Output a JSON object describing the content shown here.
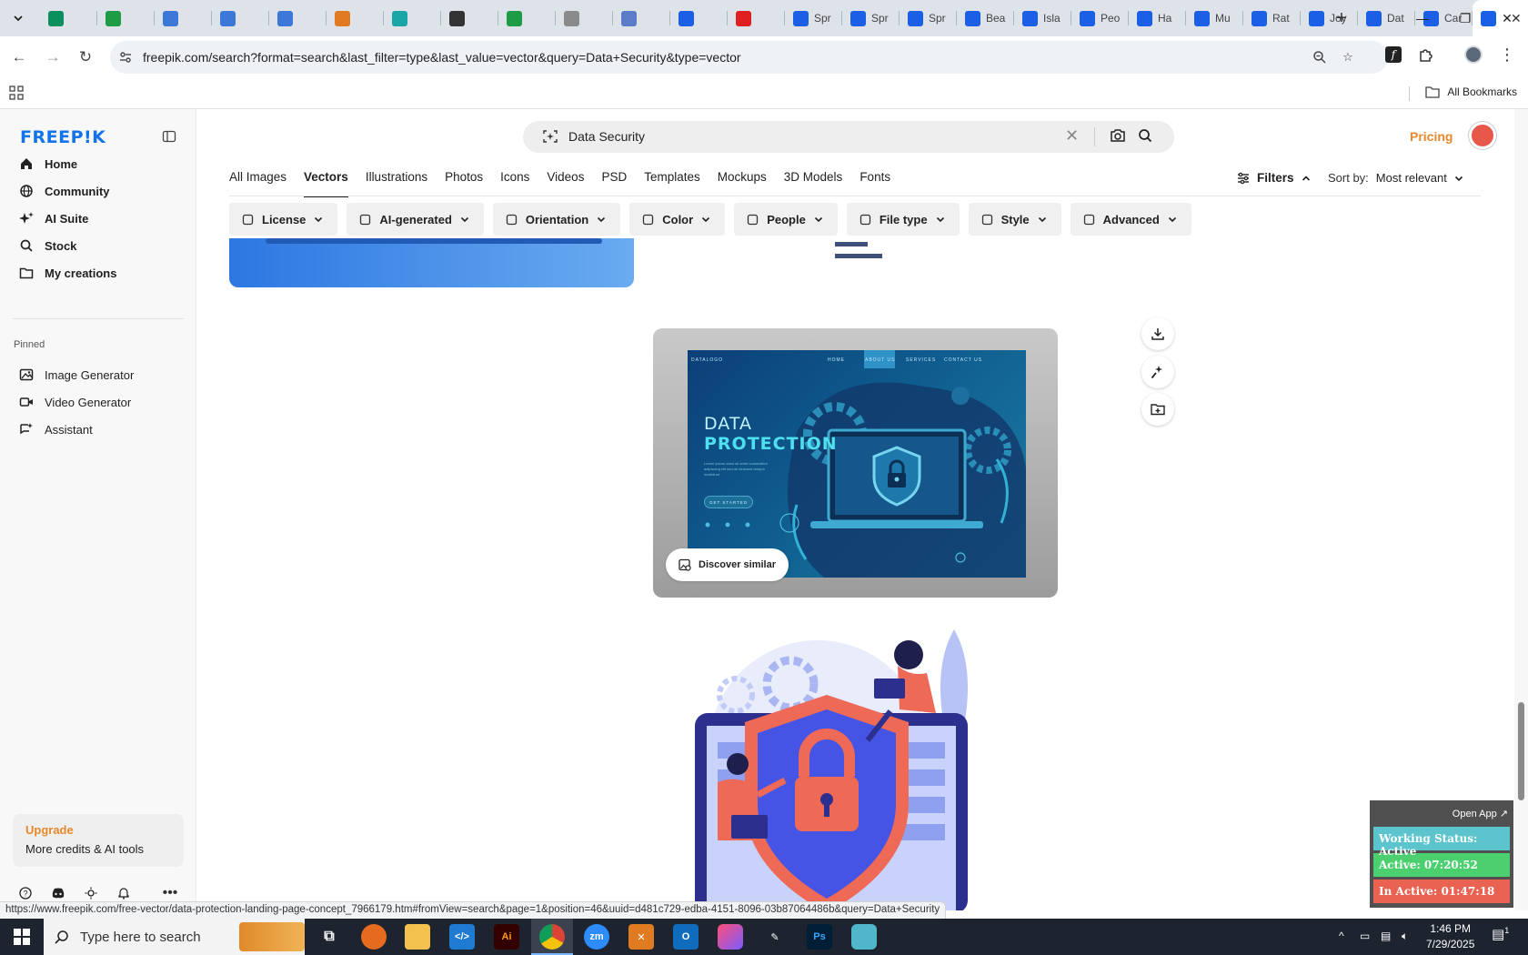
{
  "browser": {
    "tabs": [
      {
        "title": "",
        "color": "#0b8f5f",
        "icon": "globe-icon"
      },
      {
        "title": "",
        "color": "#1e9b45",
        "icon": "sheets-icon"
      },
      {
        "title": "",
        "color": "#3c78d8",
        "icon": "docs-icon"
      },
      {
        "title": "",
        "color": "#3c78d8",
        "icon": "docs-icon"
      },
      {
        "title": "",
        "color": "#3c78d8",
        "icon": "docs-icon"
      },
      {
        "title": "",
        "color": "#e07b22",
        "icon": "xampp-icon"
      },
      {
        "title": "",
        "color": "#1aa6a6",
        "icon": "app-icon"
      },
      {
        "title": "",
        "color": "#333333",
        "icon": "chatgpt-icon"
      },
      {
        "title": "",
        "color": "#1e9b45",
        "icon": "sheets-icon"
      },
      {
        "title": "",
        "color": "#8a8a8a",
        "icon": "globe-icon"
      },
      {
        "title": "",
        "color": "#5b7cc8",
        "icon": "app-icon"
      },
      {
        "title": "",
        "color": "#1b5fe6",
        "icon": "freepik-icon"
      },
      {
        "title": "",
        "color": "#e02020",
        "icon": "youtube-icon"
      },
      {
        "title": "Spr",
        "color": "#1b5fe6",
        "icon": "freepik-icon"
      },
      {
        "title": "Spr",
        "color": "#1b5fe6",
        "icon": "freepik-icon"
      },
      {
        "title": "Spr",
        "color": "#1b5fe6",
        "icon": "freepik-icon"
      },
      {
        "title": "Bea",
        "color": "#1b5fe6",
        "icon": "freepik-icon"
      },
      {
        "title": "Isla",
        "color": "#1b5fe6",
        "icon": "freepik-icon"
      },
      {
        "title": "Peo",
        "color": "#1b5fe6",
        "icon": "freepik-icon"
      },
      {
        "title": "Ha",
        "color": "#1b5fe6",
        "icon": "freepik-icon"
      },
      {
        "title": "Mu",
        "color": "#1b5fe6",
        "icon": "freepik-icon"
      },
      {
        "title": "Rat",
        "color": "#1b5fe6",
        "icon": "freepik-icon"
      },
      {
        "title": "Joy",
        "color": "#1b5fe6",
        "icon": "freepik-icon"
      },
      {
        "title": "Dat",
        "color": "#1b5fe6",
        "icon": "freepik-icon"
      },
      {
        "title": "Car",
        "color": "#1b5fe6",
        "icon": "freepik-icon"
      }
    ],
    "active_tab_title": "",
    "url": "freepik.com/search?format=search&last_filter=type&last_value=vector&query=Data+Security&type=vector",
    "bookmarks_all": "All Bookmarks"
  },
  "sidebar": {
    "logo": "FREEP!K",
    "items": [
      {
        "label": "Home",
        "icon": "home-icon"
      },
      {
        "label": "Community",
        "icon": "globe-icon"
      },
      {
        "label": "AI Suite",
        "icon": "sparkle-icon"
      },
      {
        "label": "Stock",
        "icon": "search-icon"
      },
      {
        "label": "My creations",
        "icon": "folder-icon"
      }
    ],
    "pinned_label": "Pinned",
    "pinned": [
      {
        "label": "Image Generator",
        "icon": "image-icon"
      },
      {
        "label": "Video Generator",
        "icon": "video-icon"
      },
      {
        "label": "Assistant",
        "icon": "assistant-icon"
      }
    ],
    "upgrade_title": "Upgrade",
    "upgrade_sub": "More credits & AI tools"
  },
  "header": {
    "search_query": "Data Security",
    "pricing": "Pricing",
    "type_tabs": [
      "All Images",
      "Vectors",
      "Illustrations",
      "Photos",
      "Icons",
      "Videos",
      "PSD",
      "Templates",
      "Mockups",
      "3D Models",
      "Fonts"
    ],
    "active_type": "Vectors",
    "filters_label": "Filters",
    "sort_label": "Sort by:",
    "sort_value": "Most relevant",
    "chips": [
      {
        "label": "License",
        "icon": "license-icon"
      },
      {
        "label": "AI-generated",
        "icon": "ai-icon"
      },
      {
        "label": "Orientation",
        "icon": "orientation-icon"
      },
      {
        "label": "Color",
        "icon": "palette-icon"
      },
      {
        "label": "People",
        "icon": "people-icon"
      },
      {
        "label": "File type",
        "icon": "file-icon"
      },
      {
        "label": "Style",
        "icon": "brush-icon"
      },
      {
        "label": "Advanced",
        "icon": "gear-icon"
      }
    ]
  },
  "card": {
    "art_brand": "DATALOGO",
    "art_nav": [
      "HOME",
      "ABOUT US",
      "SERVICES",
      "CONTACT US"
    ],
    "art_title_line1": "DATA",
    "art_title_line2": "PROTECTION",
    "art_lorem": "Lorem ipsum dolor sit amet consectetur adipiscing elit sed do eiusmod tempor incididunt",
    "art_button": "GET STARTED",
    "discover_label": "Discover similar"
  },
  "status_url": "https://www.freepik.com/free-vector/data-protection-landing-page-concept_7966179.htm#fromView=search&page=1&position=46&uuid=d481c729-edba-4151-8096-03b87064486b&query=Data+Security",
  "tracker": {
    "open_app": "Open App ↗",
    "working_status": "Working Status: Active",
    "active": "Active: 07:20:52",
    "inactive": "In Active: 01:47:18"
  },
  "taskbar": {
    "search_placeholder": "Type here to search",
    "time": "1:46 PM",
    "date": "7/29/2025",
    "notification_count": "1"
  }
}
